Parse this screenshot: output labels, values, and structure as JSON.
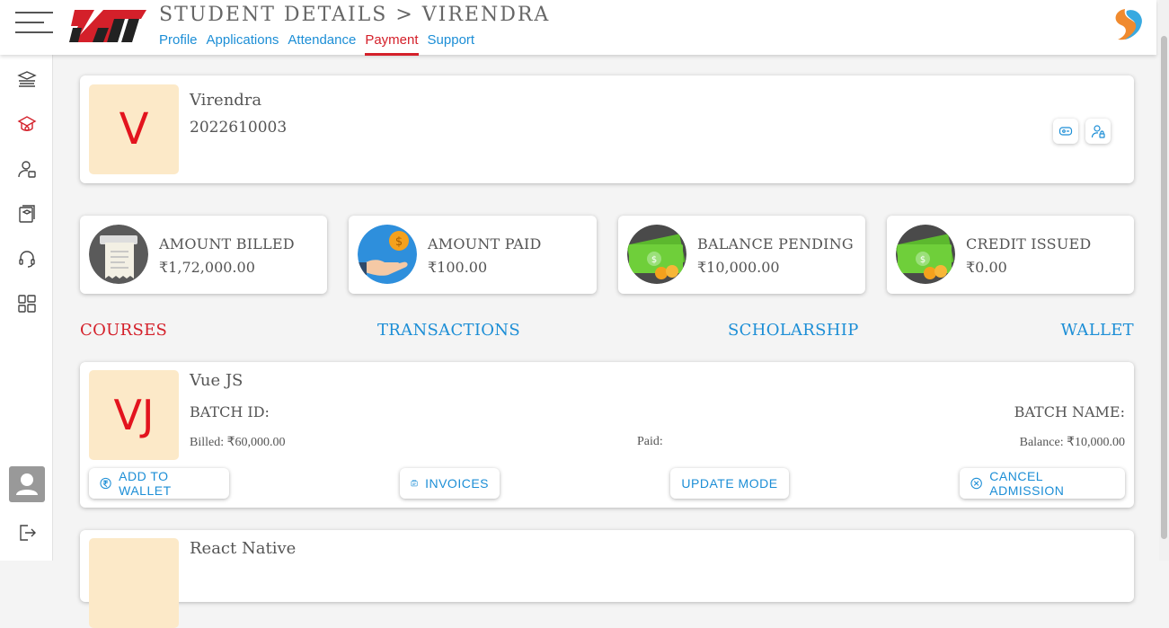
{
  "header": {
    "title_prefix": "STUDENT DETAILS > ",
    "title_name": "VIRENDRA",
    "logo_text": "KII",
    "tabs": [
      {
        "label": "Profile"
      },
      {
        "label": "Applications"
      },
      {
        "label": "Attendance"
      },
      {
        "label": "Payment"
      },
      {
        "label": "Support"
      }
    ],
    "active_tab": "Payment"
  },
  "sidebar": {
    "icons": [
      "graduation-books-icon",
      "school-cap-icon",
      "user-card-icon",
      "books-icon",
      "headset-icon",
      "apps-grid-icon",
      "user-avatar-icon",
      "logout-icon"
    ],
    "active": "school-cap-icon"
  },
  "student": {
    "initial": "V",
    "name": "Virendra",
    "id": "2022610003"
  },
  "stats": [
    {
      "label": "AMOUNT BILLED",
      "value": "₹1,72,000.00",
      "icon": "receipt-icon"
    },
    {
      "label": "AMOUNT PAID",
      "value": "₹100.00",
      "icon": "hand-coin-icon"
    },
    {
      "label": "BALANCE PENDING",
      "value": "₹10,000.00",
      "icon": "cash-coins-icon"
    },
    {
      "label": "CREDIT ISSUED",
      "value": "₹0.00",
      "icon": "cash-coins-icon"
    }
  ],
  "sections": {
    "courses": "COURSES",
    "transactions": "TRANSACTIONS",
    "scholarship": "SCHOLARSHIP",
    "wallet": "WALLET",
    "active": "COURSES"
  },
  "courses": [
    {
      "initials": "VJ",
      "name": "Vue JS",
      "batch_id_label": "BATCH ID:",
      "batch_name_label": "BATCH NAME:",
      "billed": "Billed: ₹60,000.00",
      "paid": "Paid:",
      "balance": "Balance: ₹10,000.00",
      "buttons": {
        "add_to_wallet": "ADD TO WALLET",
        "invoices": "INVOICES",
        "update_mode": "UPDATE MODE",
        "cancel_admission": "CANCEL ADMISSION"
      }
    },
    {
      "initials": "",
      "name": "React Native"
    }
  ],
  "colors": {
    "accent_blue": "#1c8ed6",
    "accent_red": "#d4202a",
    "initials_bg": "#fce9c8"
  }
}
